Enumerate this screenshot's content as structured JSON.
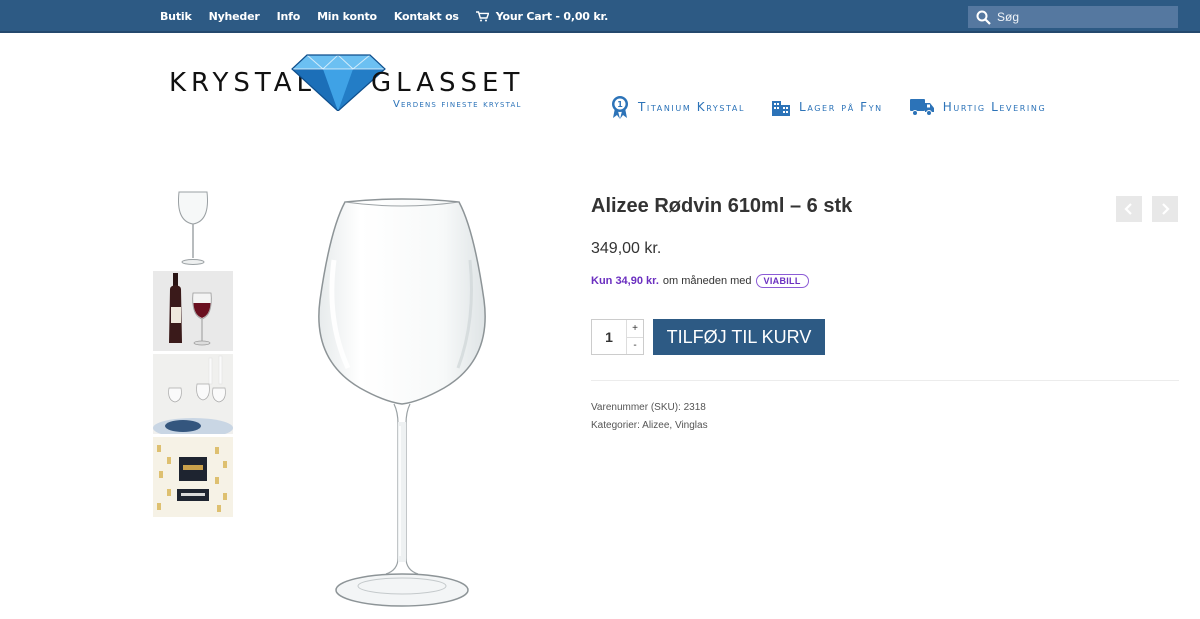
{
  "topnav": {
    "items": [
      "Butik",
      "Nyheder",
      "Info",
      "Min konto",
      "Kontakt os"
    ],
    "cart_label": "Your Cart - 0,00 kr."
  },
  "search": {
    "placeholder": "Søg"
  },
  "logo": {
    "word1": "KRYSTAL",
    "word2": "GLASSET",
    "tagline": "Verdens fineste krystal"
  },
  "features": [
    "Titanium Krystal",
    "Lager på Fyn",
    "Hurtig Levering"
  ],
  "product": {
    "title": "Alizee Rødvin 610ml – 6 stk",
    "price": "349,00 kr.",
    "viabill_amount": "Kun 34,90 kr.",
    "viabill_text": "om måneden med",
    "viabill_badge": "VIABILL",
    "quantity": "1",
    "qty_plus": "+",
    "qty_minus": "-",
    "add_to_cart": "TILFØJ TIL KURV",
    "sku_label": "Varenummer (SKU):",
    "sku": "2318",
    "categories_label": "Kategorier:",
    "category_1": "Alizee",
    "category_sep": ",",
    "category_2": "Vinglas"
  },
  "colors": {
    "header": "#2d5a84",
    "accent": "#2c73b8",
    "viabill": "#6b2fc0"
  },
  "icons": [
    "search-icon",
    "cart-icon",
    "diamond-logo-icon",
    "award-badge-icon",
    "warehouse-icon",
    "truck-icon",
    "chevron-left-icon",
    "chevron-right-icon"
  ]
}
